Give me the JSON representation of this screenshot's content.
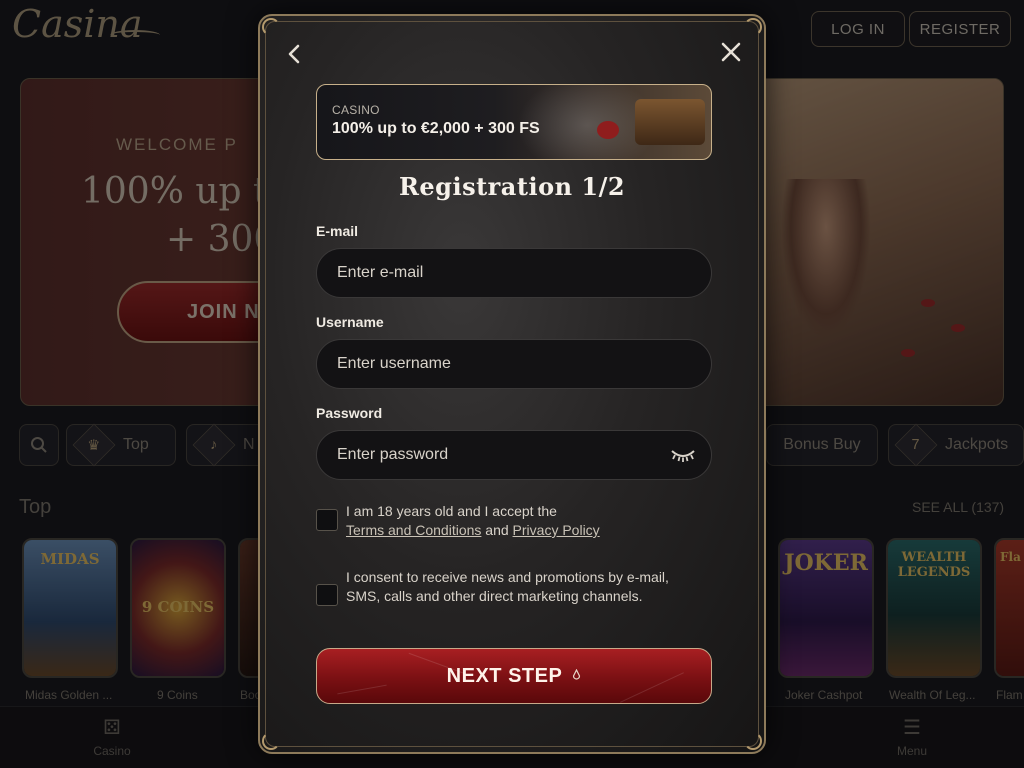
{
  "header": {
    "logo_text": "Casina",
    "login_label": "LOG IN",
    "register_label": "REGISTER"
  },
  "hero": {
    "welcome": "WELCOME P",
    "line1": "100% up to",
    "line2": "+ 300",
    "join_label": "JOIN N"
  },
  "categories": {
    "top": "Top",
    "new": "N",
    "bonus_buy": "Bonus Buy",
    "jackpots": "Jackpots"
  },
  "games_section": {
    "title": "Top",
    "see_all": "SEE ALL (137)",
    "games": [
      {
        "name": "Midas Golden ...",
        "art_text": "MIDAS"
      },
      {
        "name": "9 Coins",
        "art_text": "9 COINS"
      },
      {
        "name": "Boo",
        "art_text": ""
      },
      {
        "name": "Joker Cashpot",
        "art_text": "JOKER"
      },
      {
        "name": "Wealth Of Leg...",
        "art_text": "WEALTH LEGENDS"
      },
      {
        "name": "Flam",
        "art_text": "Fla"
      }
    ]
  },
  "bottom_nav": {
    "casino": "Casino",
    "menu": "Menu"
  },
  "modal": {
    "back_icon": "chevron-left-icon",
    "close_icon": "close-icon",
    "promo": {
      "label": "CASINO",
      "offer": "100% up to €2,000 + 300 FS"
    },
    "title": "Registration 1/2",
    "email": {
      "label": "E-mail",
      "placeholder": "Enter e-mail"
    },
    "username": {
      "label": "Username",
      "placeholder": "Enter username"
    },
    "password": {
      "label": "Password",
      "placeholder": "Enter password"
    },
    "consent_age": {
      "text_before": "I am 18 years old and I accept the",
      "terms_link": "Terms and Conditions",
      "and": "and",
      "privacy_link": "Privacy Policy"
    },
    "consent_marketing": {
      "text": "I consent to receive news and promotions by e-mail, SMS, calls and other direct marketing channels."
    },
    "next_label": "NEXT STEP"
  },
  "colors": {
    "accent_red": "#8f1518",
    "gold_border": "#8d7a5a",
    "modal_bg": "#262424"
  }
}
